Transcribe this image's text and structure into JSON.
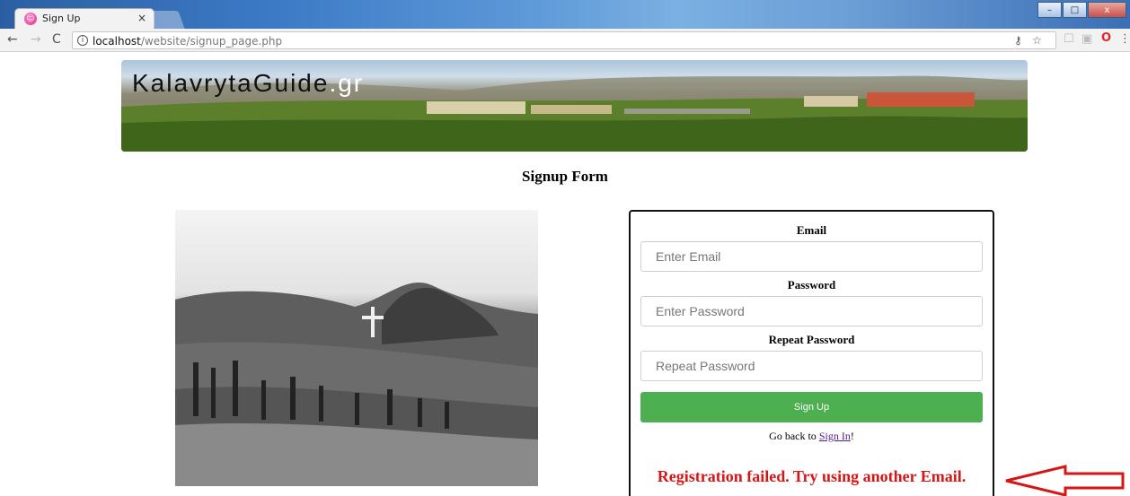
{
  "browser": {
    "tab_title": "Sign Up",
    "tab_close": "×",
    "url_host": "localhost",
    "url_path": "/website/signup_page.php",
    "info_glyph": "i",
    "controls": {
      "minimize": "–",
      "maximize": "□",
      "close": "x"
    }
  },
  "header": {
    "logo_text": "KalavrytaGuide",
    "logo_tld": ".gr"
  },
  "page": {
    "title": "Signup Form"
  },
  "form": {
    "email_label": "Email",
    "email_placeholder": "Enter Email",
    "password_label": "Password",
    "password_placeholder": "Enter Password",
    "repeat_label": "Repeat Password",
    "repeat_placeholder": "Repeat Password",
    "submit_label": "Sign Up",
    "goback_prefix": "Go back to ",
    "goback_link": "Sign In",
    "goback_suffix": "!",
    "error_message": "Registration failed. Try using another Email."
  },
  "colors": {
    "button": "#4caf50",
    "error": "#d61616",
    "arrow": "#d61616",
    "link": "#551a8b"
  },
  "icons": {
    "back": "arrow-left-icon",
    "forward": "arrow-right-icon",
    "reload": "reload-icon",
    "info": "info-icon",
    "key": "key-icon",
    "bookmark": "star-icon",
    "opera": "opera-icon"
  }
}
